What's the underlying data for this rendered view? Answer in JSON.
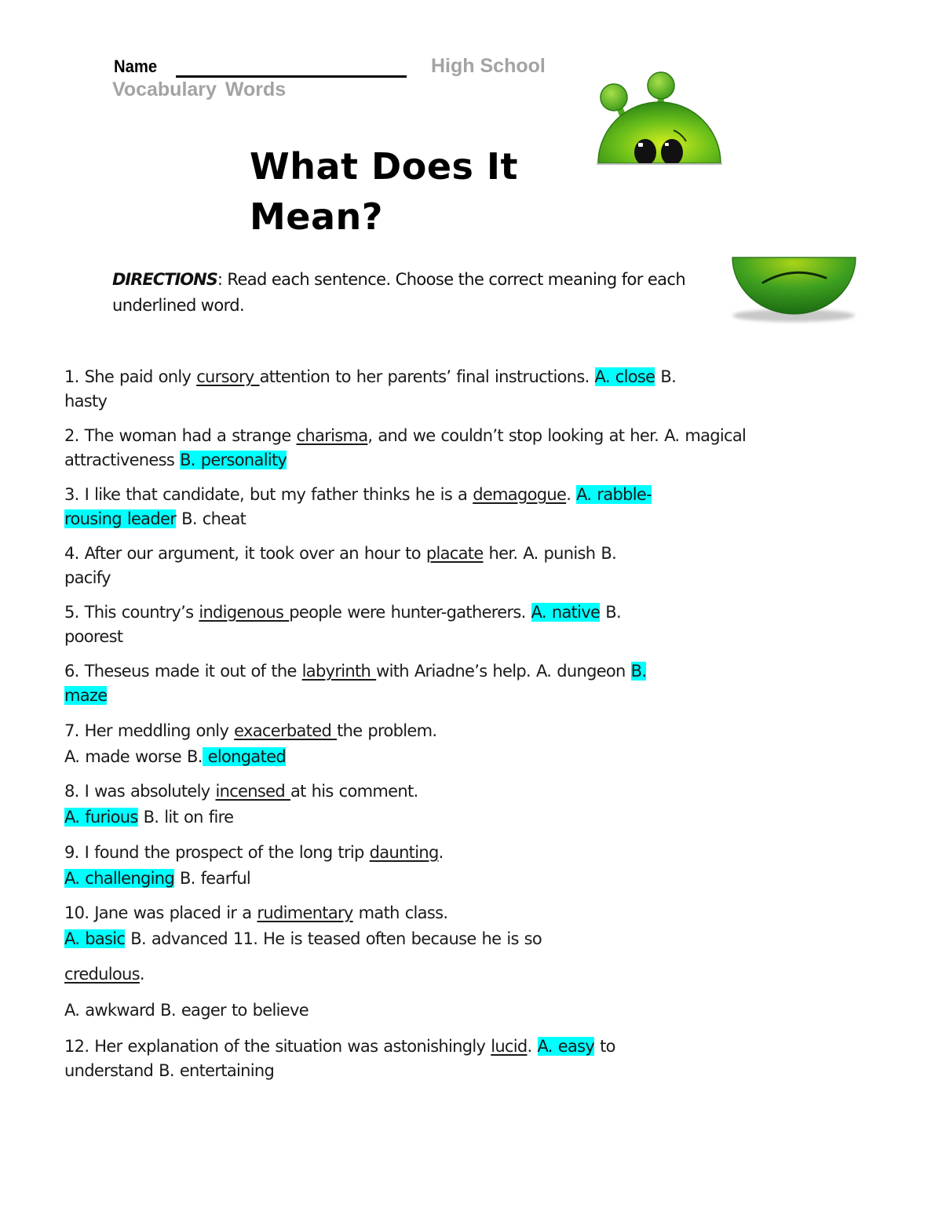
{
  "header": {
    "name_label": "Name",
    "school_label": "High School",
    "subject_label": "Vocabulary  Words"
  },
  "title": {
    "line1": "What Does It",
    "line2": "Mean?"
  },
  "directions": {
    "label": "DIRECTIONS",
    "text": ": Read each sentence. Choose the correct meaning for each underlined word."
  },
  "images": {
    "top": "alien-peeking-icon",
    "bottom": "alien-frown-icon"
  },
  "colors": {
    "highlight": "#00ffff",
    "header_gray": "#a3a3a3",
    "alien_green": "#4caf1a"
  },
  "questions": [
    {
      "pre": " 1. She paid only ",
      "word": "cursory ",
      "post": "attention to her parents’ final instructions.   ",
      "hl": "A. close",
      "tail": " B.",
      "line2": "hasty"
    },
    {
      "pre": " 2. The woman had a strange ",
      "word": "charisma",
      "post": ", and we couldn’t stop looking at her.   A. magical",
      "line2_pre": "attractiveness ",
      "line2_hl": "B. personality  "
    },
    {
      "pre": " 3. I like that candidate, but my father thinks he is a ",
      "word": "demagogue",
      "post": ".   ",
      "hl": "A. rabble-",
      "line2_hl": "rousing leader",
      "line2_post": " B. cheat"
    },
    {
      "pre": " 4. After our argument, it took over an hour to ",
      "word": "placate",
      "post": " her.   A. punish B.",
      "line2": "pacify"
    },
    {
      "pre": " 5. This country’s ",
      "word": "indigenous ",
      "post": "people were hunter-gatherers.   ",
      "hl": "A. native",
      "tail": " B.",
      "line2": "poorest"
    },
    {
      "pre": " 6. Theseus made it out of the ",
      "word": "labyrinth ",
      "post": "with Ariadne’s help.   A. dungeon ",
      "hl": "B.",
      "line2_hl": "maze "
    },
    {
      "pre": " 7. Her meddling only ",
      "word": "exacerbated ",
      "post": "the problem.",
      "line2_pre": " A. made worse B.",
      "line2_hl": " elongated  "
    },
    {
      "pre": " 8. I was absolutely ",
      "word": "incensed ",
      "post": "at his comment.",
      "line2_hl": " A. furious",
      "line2_post": " B. lit on fire"
    },
    {
      "pre": " 9. I found the prospect of the long trip ",
      "word": "daunting",
      "post": ".",
      "line2_hl": " A. challenging",
      "line2_post": " B. fearful"
    },
    {
      "pre": " 10. Jane was placed ir  a ",
      "word": "rudimentary",
      "post": " math class.",
      "line2_hl": " A. basic",
      "line2_post": " B. advanced   11. He is teased often because he is so"
    },
    {
      "word": "credulous",
      "post": "."
    },
    {
      "line": " A. awkward B. eager to believe"
    },
    {
      "pre": " 12. Her explanation of the situation was astonishingly ",
      "word": "lucid",
      "post": ".  ",
      "hl": "A. easy",
      "tail": " to",
      "line2": "understand B. entertaining"
    }
  ]
}
